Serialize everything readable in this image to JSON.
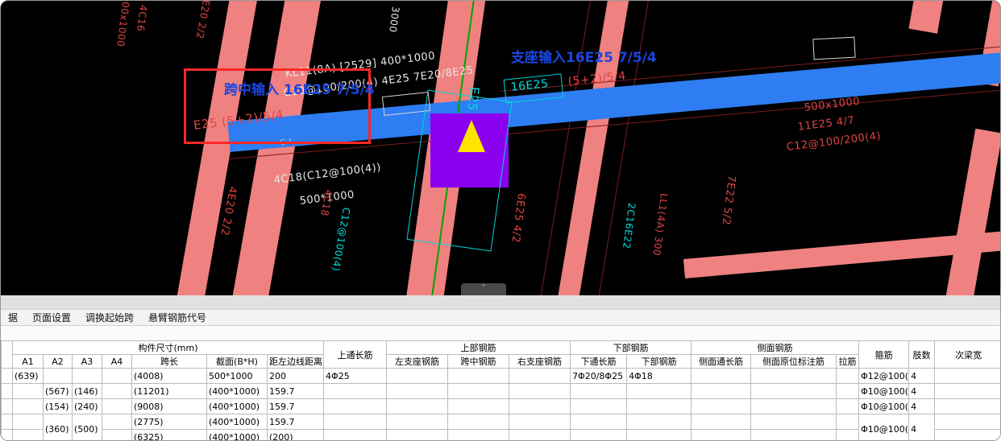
{
  "colors": {
    "selected_beam_blue": "#2e7df2",
    "beam_pink": "#ef8181",
    "selection_purple": "#8b00ef",
    "marker_yellow": "#ffe400",
    "highlight_box_red": "#ff2727",
    "annotation_blue": "#1b46e0",
    "cad_text_red": "#e04545",
    "cad_text_cyan": "#00dede"
  },
  "cad": {
    "labels": [
      "00x1000",
      "4C16",
      "E20 2/2",
      "3000",
      "KL11(8A) [2529] 400*1000",
      "C10@100/200(4) 4E25 7E20/8E25",
      "16E25",
      "(5+2)/5/4",
      "E25",
      "E25 (5+2)/5/4",
      "G-L",
      "4C18(C12@100(4))",
      "500*1000",
      "4C18",
      "C12@100(4)",
      "4E20 2/2",
      "6E25 4/2",
      "2C16E22",
      "LL1(4A) 300",
      "7E22 5/2",
      "500x1000",
      "11E25 4/7",
      "C12@100/200(4)",
      "支座输入16E25 7/5/4",
      "跨中输入 16E25 7/5/4"
    ],
    "collapse_tab_icon": "˅"
  },
  "menu": {
    "items": [
      "据",
      "页面设置",
      "调换起始跨",
      "悬臂钢筋代号"
    ]
  },
  "table": {
    "header_row1": [
      {
        "label": "",
        "rowspan": 2
      },
      {
        "label": "构件尺寸(mm)",
        "colspan": 7
      },
      {
        "label": "上通长筋",
        "rowspan": 2
      },
      {
        "label": "上部钢筋",
        "colspan": 3
      },
      {
        "label": "下部钢筋",
        "colspan": 2
      },
      {
        "label": "侧面钢筋",
        "colspan": 3
      },
      {
        "label": "箍筋",
        "rowspan": 2
      },
      {
        "label": "肢数",
        "rowspan": 2
      },
      {
        "label": "次梁宽",
        "rowspan": 2
      }
    ],
    "header_row2": [
      "A1",
      "A2",
      "A3",
      "A4",
      "跨长",
      "截面(B*H)",
      "距左边线距离",
      "左支座钢筋",
      "跨中钢筋",
      "右支座钢筋",
      "下通长筋",
      "下部钢筋",
      "侧面通长筋",
      "侧面原位标注筋",
      "拉筋"
    ],
    "rows": [
      [
        "",
        "(639)",
        "",
        "",
        "",
        "(4008)",
        "500*1000",
        "200",
        "4Φ25",
        "",
        "",
        "",
        "7Φ20/8Φ25",
        "4Φ18",
        "",
        "",
        "",
        "Φ12@100(",
        "4",
        ""
      ],
      [
        "",
        "",
        "(567)",
        "(146)",
        "",
        "(11201)",
        "(400*1000)",
        "159.7",
        "",
        "",
        "",
        "",
        "",
        "",
        "",
        "",
        "",
        "Φ10@100(",
        "4",
        ""
      ],
      [
        "",
        "",
        "(154)",
        "(240)",
        "",
        "(9008)",
        "(400*1000)",
        "159.7",
        "",
        "",
        "",
        "",
        "",
        "",
        "",
        "",
        "",
        "Φ10@100(",
        "4",
        ""
      ],
      [
        "",
        "",
        {
          "t": "(360)",
          "rs": 2
        },
        {
          "t": "(500)",
          "rs": 2
        },
        "",
        "(2775)",
        "(400*1000)",
        "159.7",
        "",
        "",
        "",
        "",
        "",
        "",
        "",
        "",
        "",
        {
          "t": "Φ10@100(",
          "rs": 2
        },
        {
          "t": "4",
          "rs": 2
        },
        ""
      ],
      [
        "",
        "",
        null,
        null,
        "",
        "(6325)",
        "(400*1000)",
        "(200)",
        "",
        "",
        "",
        "",
        "",
        "",
        "",
        "",
        "",
        null,
        null,
        ""
      ]
    ]
  }
}
